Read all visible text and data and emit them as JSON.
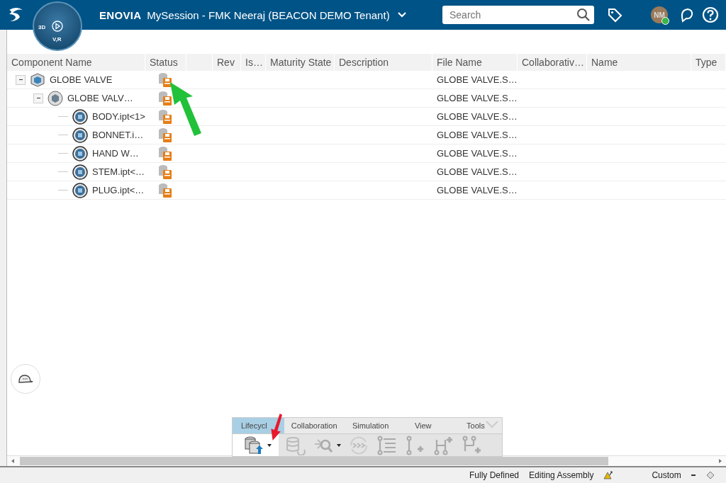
{
  "header": {
    "compass_labels": [
      "3D",
      "V,R"
    ],
    "brand": "ENOVIA",
    "session": "MySession - FMK Neeraj (BEACON DEMO Tenant)",
    "search": {
      "placeholder": "Search"
    },
    "avatar_initials": "NM"
  },
  "table": {
    "columns": [
      "Component Name",
      "Status",
      "",
      "Rev",
      "Is…",
      "Maturity State",
      "Description",
      "File Name",
      "Collaborativ…",
      "Name",
      "Type"
    ],
    "rows": [
      {
        "name": "GLOBE VALVE",
        "kind": "assembly",
        "file_name": "GLOBE VALVE.S…",
        "expanded": true,
        "children": [
          {
            "name": "GLOBE VALV…",
            "kind": "subassembly",
            "file_name": "GLOBE VALVE.S…",
            "expanded": true,
            "children": [
              {
                "name": "BODY.ipt<1>",
                "kind": "part",
                "file_name": "GLOBE VALVE.S…"
              },
              {
                "name": "BONNET.i…",
                "kind": "part",
                "file_name": "GLOBE VALVE.S…"
              },
              {
                "name": "HAND W…",
                "kind": "part",
                "file_name": "GLOBE VALVE.S…"
              },
              {
                "name": "STEM.ipt<…",
                "kind": "part",
                "file_name": "GLOBE VALVE.S…"
              },
              {
                "name": "PLUG.ipt<…",
                "kind": "part",
                "file_name": "GLOBE VALVE.S…"
              }
            ]
          }
        ]
      }
    ]
  },
  "toolbar": {
    "tabs": [
      {
        "label": "Lifecycl",
        "selected": true
      },
      {
        "label": "Collaboration",
        "selected": false
      },
      {
        "label": "Simulation",
        "selected": false
      },
      {
        "label": "View",
        "selected": false
      },
      {
        "label": "Tools",
        "selected": false
      }
    ],
    "tools": [
      {
        "kind": "save-db",
        "enabled": true,
        "dropdown": true
      },
      {
        "kind": "refresh-db",
        "enabled": false,
        "dropdown": false
      },
      {
        "kind": "explore",
        "enabled": false,
        "dropdown": true
      },
      {
        "kind": "sync",
        "enabled": false,
        "dropdown": false
      },
      {
        "kind": "tree",
        "enabled": false,
        "dropdown": false
      },
      {
        "kind": "add-one",
        "enabled": false,
        "dropdown": false
      },
      {
        "kind": "add-h",
        "enabled": false,
        "dropdown": false
      },
      {
        "kind": "add-h2",
        "enabled": false,
        "dropdown": false
      }
    ]
  },
  "status_bar": {
    "items": [
      "Fully Defined",
      "Editing Assembly"
    ],
    "mode": "Custom"
  }
}
